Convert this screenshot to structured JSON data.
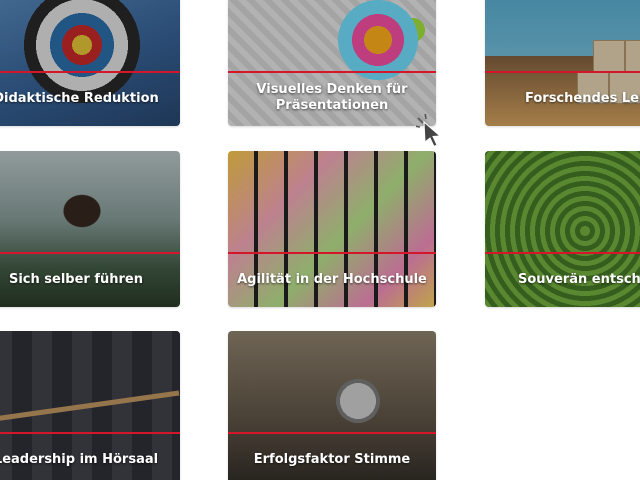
{
  "tiles": [
    {
      "label": "Didaktische Reduktion"
    },
    {
      "label": "Visuelles Denken für Präsentationen"
    },
    {
      "label": "Forschendes Lerne"
    },
    {
      "label": "Sich selber führen"
    },
    {
      "label": "Agilität in der Hochschule"
    },
    {
      "label": "Souverän entschei"
    },
    {
      "label": "Leadership im Hörsaal"
    },
    {
      "label": "Erfolgsfaktor Stimme"
    }
  ],
  "colors": {
    "accent_line": "#d4162a",
    "label_text": "#ffffff",
    "page_background": "#ffffff"
  },
  "icons": {
    "cursor": "pointer-arrow-icon"
  }
}
